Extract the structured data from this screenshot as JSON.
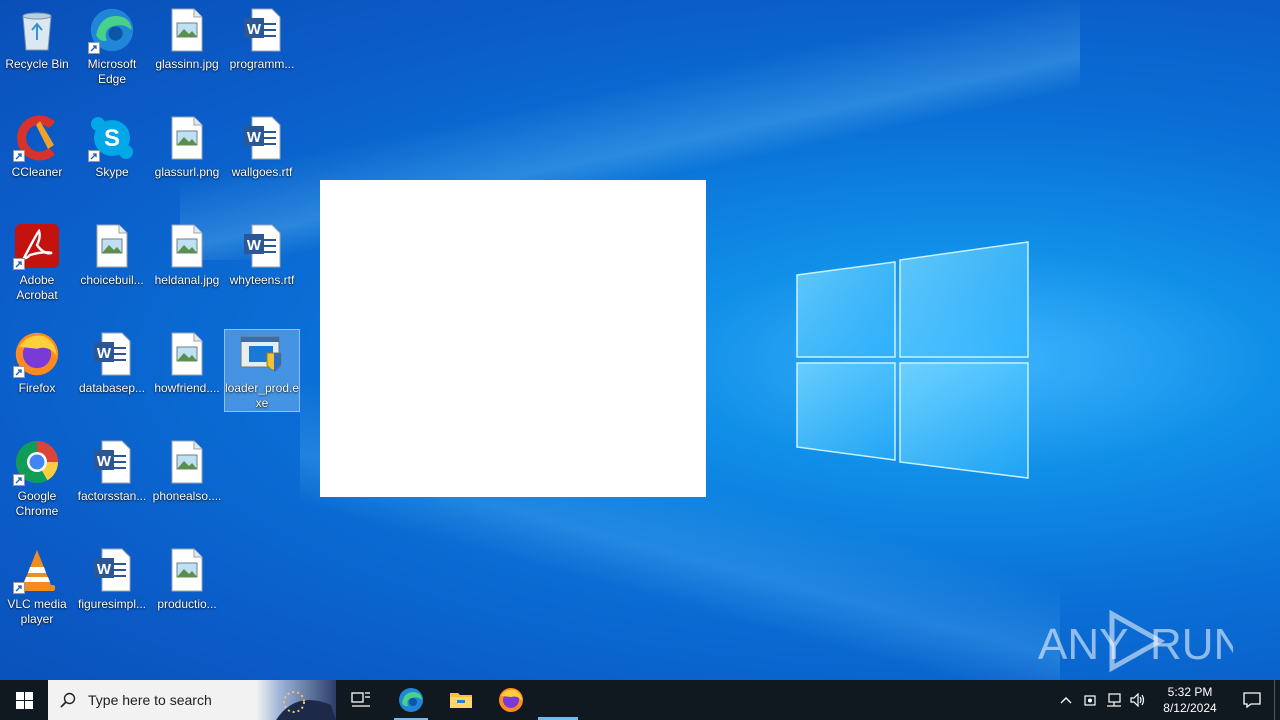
{
  "desktop": {
    "icons": [
      {
        "label": "Recycle Bin",
        "icon": "recycle-bin-icon"
      },
      {
        "label": "Microsoft Edge",
        "icon": "edge-icon"
      },
      {
        "label": "glassinn.jpg",
        "icon": "image-file-icon"
      },
      {
        "label": "programm...",
        "icon": "word-document-icon"
      },
      {
        "label": "CCleaner",
        "icon": "ccleaner-icon"
      },
      {
        "label": "Skype",
        "icon": "skype-icon"
      },
      {
        "label": "glassurl.png",
        "icon": "image-file-icon"
      },
      {
        "label": "wallgoes.rtf",
        "icon": "word-document-icon"
      },
      {
        "label": "Adobe Acrobat",
        "icon": "acrobat-icon"
      },
      {
        "label": "choicebuil...",
        "icon": "image-file-icon"
      },
      {
        "label": "heldanal.jpg",
        "icon": "image-file-icon"
      },
      {
        "label": "whyteens.rtf",
        "icon": "word-document-icon"
      },
      {
        "label": "Firefox",
        "icon": "firefox-icon"
      },
      {
        "label": "databasep...",
        "icon": "word-document-icon"
      },
      {
        "label": "howfriend....",
        "icon": "image-file-icon"
      },
      {
        "label": "loader_prod.exe",
        "icon": "installer-exe-icon"
      },
      {
        "label": "Google Chrome",
        "icon": "chrome-icon"
      },
      {
        "label": "factorsstan...",
        "icon": "word-document-icon"
      },
      {
        "label": "phonealso....",
        "icon": "image-file-icon"
      },
      {
        "label": "VLC media player",
        "icon": "vlc-icon"
      },
      {
        "label": "figuresimpl...",
        "icon": "word-document-icon"
      },
      {
        "label": "productio...",
        "icon": "image-file-icon"
      }
    ]
  },
  "watermark": {
    "text_left": "ANY",
    "text_right": "RUN"
  },
  "taskbar": {
    "search_placeholder": "Type here to search",
    "pinned": [
      "task-view-icon",
      "edge-icon",
      "file-explorer-icon",
      "firefox-icon"
    ],
    "clock_time": "5:32 PM",
    "clock_date": "8/12/2024"
  },
  "colors": {
    "taskbar_bg": "#101820",
    "accent": "#76b9ed",
    "wallpaper": "#0a6fd6"
  }
}
